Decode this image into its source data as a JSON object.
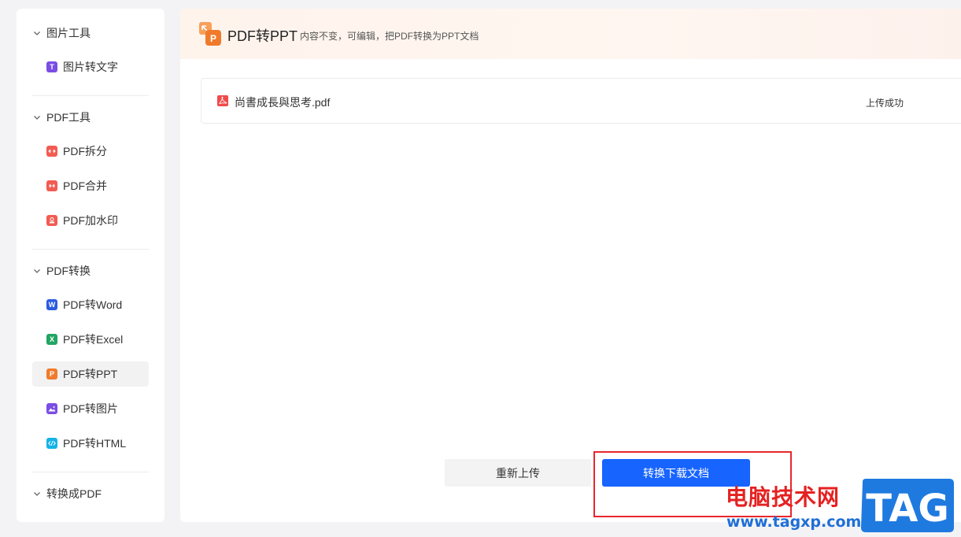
{
  "sidebar": {
    "groups": [
      {
        "label": "图片工具",
        "items": [
          {
            "label": "图片转文字",
            "icon": "T"
          }
        ]
      },
      {
        "label": "PDF工具",
        "items": [
          {
            "label": "PDF拆分"
          },
          {
            "label": "PDF合并"
          },
          {
            "label": "PDF加水印"
          }
        ]
      },
      {
        "label": "PDF转换",
        "items": [
          {
            "label": "PDF转Word",
            "icon": "W"
          },
          {
            "label": "PDF转Excel",
            "icon": "X"
          },
          {
            "label": "PDF转PPT",
            "icon": "P"
          },
          {
            "label": "PDF转图片"
          },
          {
            "label": "PDF转HTML"
          }
        ]
      },
      {
        "label": "转换成PDF",
        "items": []
      }
    ],
    "active_item": "PDF转PPT"
  },
  "header": {
    "logo_letter": "P",
    "title": "PDF转PPT",
    "subtitle": "内容不变，可编辑，把PDF转换为PPT文档"
  },
  "file": {
    "name": "尚書成長與思考.pdf",
    "status": "上传成功"
  },
  "actions": {
    "reupload_label": "重新上传",
    "convert_label": "转换下载文档"
  },
  "watermark": {
    "text": "电脑技术网",
    "url": "www.tagxp.com",
    "tag": "TAG"
  },
  "colors": {
    "accent": "#1764ff",
    "highlight": "#e8272c",
    "icon_red": "#f25b52",
    "icon_word": "#2b5be0",
    "icon_excel": "#22a463",
    "icon_ppt": "#f07a2c",
    "icon_image": "#7a4de4",
    "icon_html": "#14b3e6",
    "icon_ocr": "#7a4de4"
  }
}
